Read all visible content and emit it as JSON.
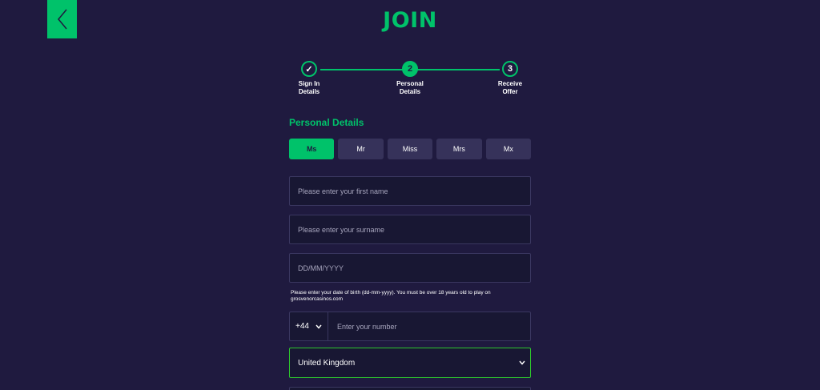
{
  "header": {
    "title": "JOIN",
    "back_icon": "chevron-left-icon"
  },
  "stepper": {
    "steps": [
      {
        "marker": "✓",
        "label_line1": "Sign In",
        "label_line2": "Details",
        "state": "done"
      },
      {
        "marker": "2",
        "label_line1": "Personal",
        "label_line2": "Details",
        "state": "active"
      },
      {
        "marker": "3",
        "label_line1": "Receive",
        "label_line2": "Offer",
        "state": "upcoming"
      }
    ]
  },
  "form": {
    "section_title": "Personal Details",
    "titles": [
      "Ms",
      "Mr",
      "Miss",
      "Mrs",
      "Mx"
    ],
    "selected_title": "Ms",
    "first_name": {
      "placeholder": "Please enter your first name",
      "value": ""
    },
    "surname": {
      "placeholder": "Please enter your surname",
      "value": ""
    },
    "dob": {
      "placeholder": "DD/MM/YYYY",
      "value": ""
    },
    "dob_hint": "Please enter your date of birth (dd-mm-yyyy). You must be over 18 years old to play on grosvenorcasinos.com",
    "phone": {
      "code": "+44",
      "placeholder": "Enter your number",
      "value": ""
    },
    "country": {
      "value": "United Kingdom"
    }
  },
  "colors": {
    "background": "#1f1a3f",
    "accent": "#00c26a",
    "field_bg": "#181733",
    "title_btn_bg": "#36325a",
    "focus_border": "#2dc52d"
  }
}
